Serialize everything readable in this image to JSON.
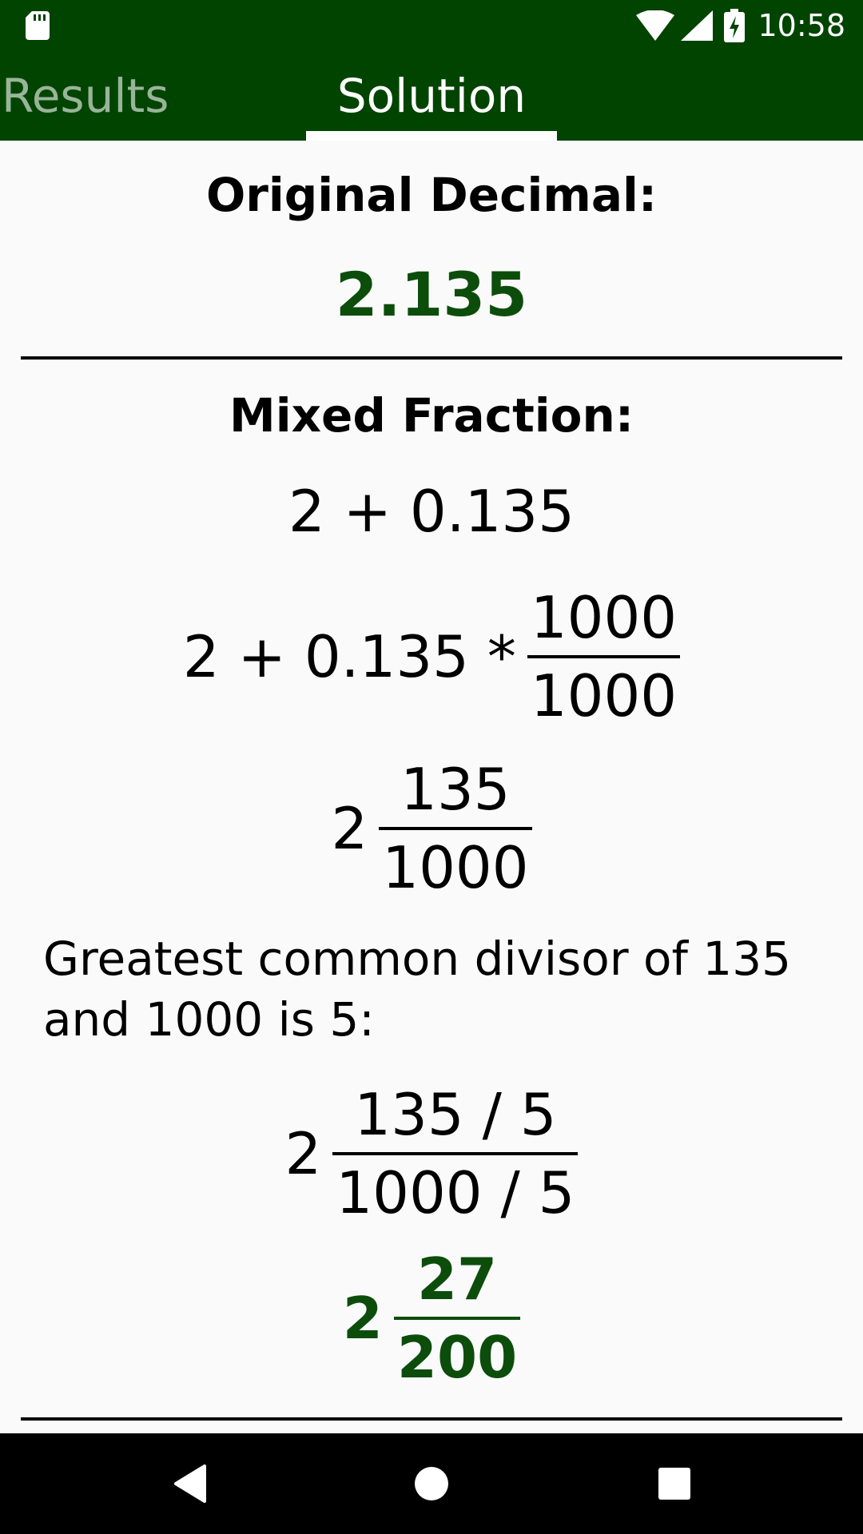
{
  "status_bar": {
    "time": "10:58",
    "icons": [
      "sd-card-icon",
      "wifi-icon",
      "cell-signal-icon",
      "battery-charging-icon"
    ]
  },
  "tabs": [
    {
      "label": "Results",
      "selected": false
    },
    {
      "label": "Solution",
      "selected": true
    }
  ],
  "colors": {
    "accent": "#004400",
    "result_green": "#0c4d0c"
  },
  "original": {
    "heading": "Original Decimal:",
    "value": "2.135"
  },
  "mixed": {
    "heading": "Mixed Fraction:",
    "step1": "2 + 0.135",
    "step2": {
      "prefix": "2 + 0.135 *",
      "numerator": "1000",
      "denominator": "1000"
    },
    "step3": {
      "whole": "2",
      "numerator": "135",
      "denominator": "1000"
    },
    "gcd_text": "Greatest common divisor of 135 and 1000 is 5:",
    "step4": {
      "whole": "2",
      "numerator": "135 / 5",
      "denominator": "1000 / 5"
    },
    "result": {
      "whole": "2",
      "numerator": "27",
      "denominator": "200"
    }
  },
  "nav": {
    "icons": [
      "back-icon",
      "home-icon",
      "recents-icon"
    ]
  }
}
